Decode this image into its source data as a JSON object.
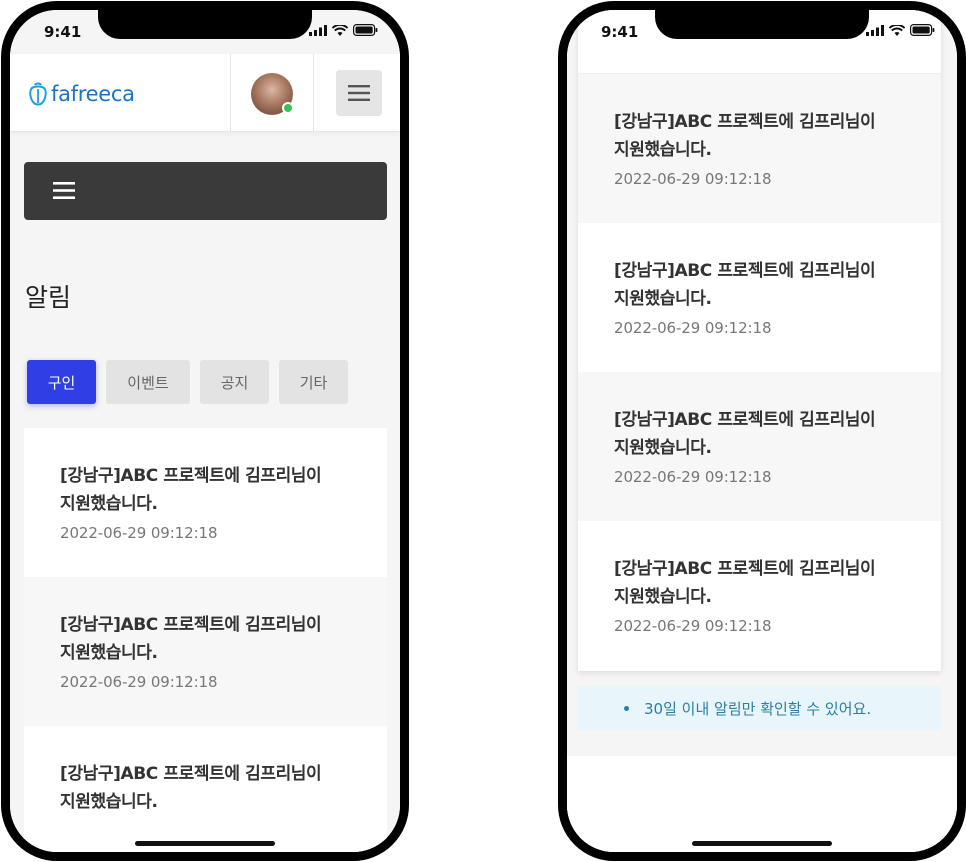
{
  "status": {
    "time": "9:41"
  },
  "header": {
    "logo_text": "fafreeca"
  },
  "page": {
    "title": "알림"
  },
  "tabs": [
    {
      "label": "구인",
      "active": true
    },
    {
      "label": "이벤트",
      "active": false
    },
    {
      "label": "공지",
      "active": false
    },
    {
      "label": "기타",
      "active": false
    }
  ],
  "notifications_left": [
    {
      "title": "[강남구]ABC 프로젝트에 김프리님이 지원했습니다.",
      "date": "2022-06-29 09:12:18"
    },
    {
      "title": "[강남구]ABC 프로젝트에 김프리님이 지원했습니다.",
      "date": "2022-06-29 09:12:18"
    },
    {
      "title": "[강남구]ABC 프로젝트에 김프리님이 지원했습니다.",
      "date": ""
    }
  ],
  "notifications_right": [
    {
      "title": "[강남구]ABC 프로젝트에 김프리님이 지원했습니다.",
      "date": "2022-06-29 09:12:18"
    },
    {
      "title": "[강남구]ABC 프로젝트에 김프리님이 지원했습니다.",
      "date": "2022-06-29 09:12:18"
    },
    {
      "title": "[강남구]ABC 프로젝트에 김프리님이 지원했습니다.",
      "date": "2022-06-29 09:12:18"
    },
    {
      "title": "[강남구]ABC 프로젝트에 김프리님이 지원했습니다.",
      "date": "2022-06-29 09:12:18"
    }
  ],
  "info": {
    "text": "30일 이내 알림만 확인할 수 있어요."
  },
  "colors": {
    "brand": "#1a73c8",
    "active_tab": "#2f3fe3",
    "dark_nav": "#3a3a3a",
    "online": "#3ac25a",
    "info_bg": "#e8f5fb",
    "info_text": "#2a7fa2"
  },
  "icons": {
    "logo": "pepper-logo-icon",
    "menu": "hamburger-icon",
    "signal": "cellular-signal-icon",
    "wifi": "wifi-icon",
    "battery": "battery-icon"
  }
}
